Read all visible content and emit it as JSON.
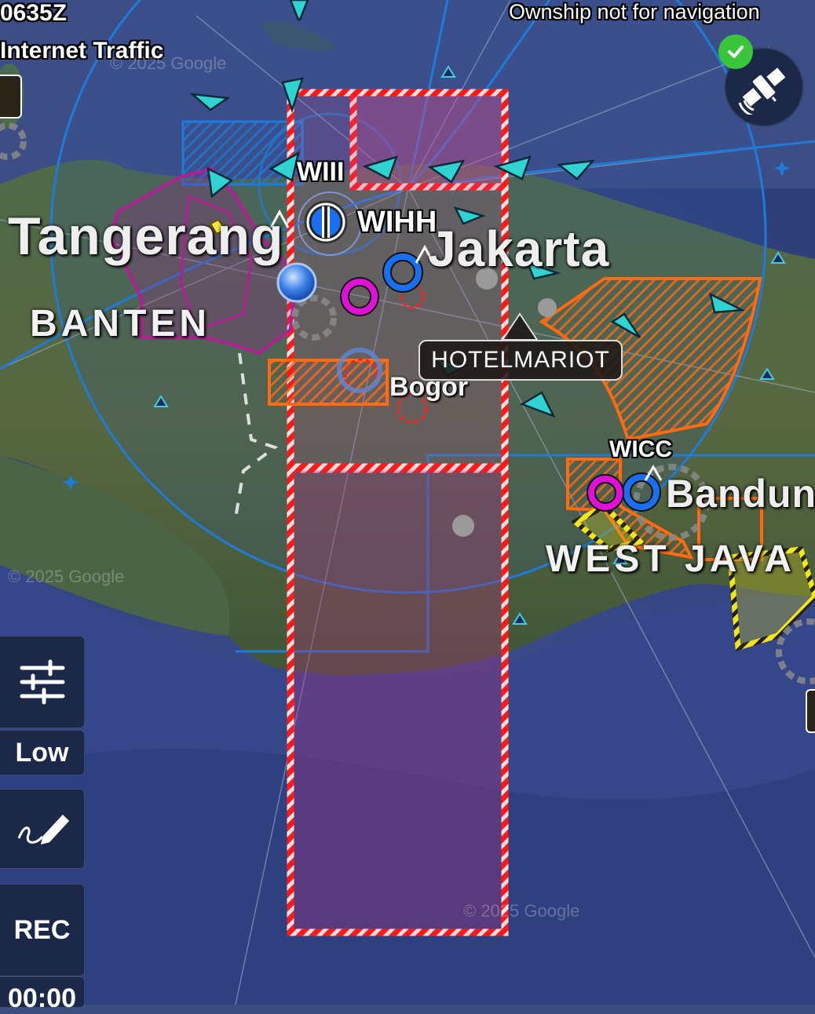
{
  "top_left": {
    "time": "0635Z",
    "traffic_source": "Internet Traffic"
  },
  "top_right": {
    "ownship_notice": "Ownship not for navigation",
    "gps_status": "connected",
    "gps_icon": "satellite-icon",
    "gps_badge_icon": "check-icon"
  },
  "map_labels": {
    "airports": [
      "WIII",
      "WIHH",
      "WICC"
    ],
    "cities": [
      "Tangerang",
      "Jakarta",
      "Bogor",
      "Bandung"
    ],
    "regions": [
      "BANTEN",
      "WEST JAVA"
    ],
    "waypoint": "HOTELMARIOT",
    "watermarks": [
      "© 2025 Google",
      "© 2025 Google",
      "© 2025 Google"
    ]
  },
  "sidebar": {
    "settings_icon": "sliders-icon",
    "quality_label": "Low",
    "draw_icon": "pencil-draw-icon",
    "record_label": "REC",
    "timer": "00:00"
  },
  "colors": {
    "restricted_red": "#ff1a1a",
    "orange_airspace": "#ff6a10",
    "magenta_airspace": "#a0208a",
    "yellow_airspace": "#f2e51a",
    "class_blue": "#1e7cd8",
    "traffic_cyan": "#2fd3d1",
    "airport_magenta": "#e010d8",
    "airport_blue": "#1a6ff0"
  }
}
